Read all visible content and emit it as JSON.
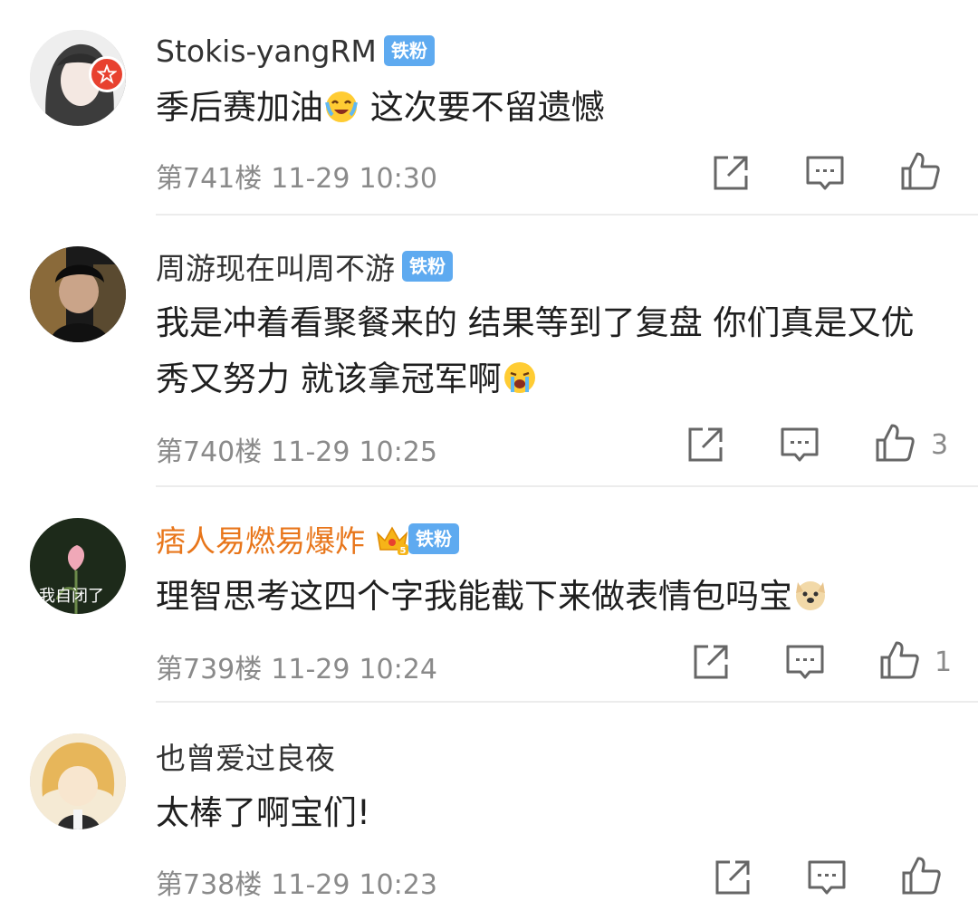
{
  "comments": [
    {
      "username": "Stokis-yangRM",
      "fan_badge": "铁粉",
      "text_parts": [
        "季后赛加油",
        " 这次要不留遗憾"
      ],
      "floor": "第741楼",
      "date": "11-29",
      "time": "10:30",
      "likes": "",
      "avatar_badge_icon": "red-star-badge-icon"
    },
    {
      "username": "周游现在叫周不游",
      "fan_badge": "铁粉",
      "text_parts": [
        "我是冲着看聚餐来的 结果等到了复盘 你们真是又优秀又努力 就该拿冠军啊"
      ],
      "floor": "第740楼",
      "date": "11-29",
      "time": "10:25",
      "likes": "3"
    },
    {
      "username": "痞人易燃易爆炸",
      "fan_badge": "铁粉",
      "level_badge": "5",
      "avatar_caption": "我自闭了",
      "text_parts": [
        "理智思考这四个字我能截下来做表情包吗宝"
      ],
      "floor": "第739楼",
      "date": "11-29",
      "time": "10:24",
      "likes": "1"
    },
    {
      "username": "也曾爱过良夜",
      "text_parts": [
        "太棒了啊宝们!"
      ],
      "floor": "第738楼",
      "date": "11-29",
      "time": "10:23",
      "likes": ""
    }
  ],
  "colors": {
    "fan_badge_bg": "#5eaaf0",
    "vip_name": "#e8761b",
    "meta_text": "#8a8a8a",
    "divider": "#ececec"
  },
  "icons": [
    "share-icon",
    "reply-icon",
    "like-icon",
    "laugh-cry-emoji-icon",
    "crying-emoji-icon",
    "doge-emoji-icon",
    "crown-icon"
  ]
}
